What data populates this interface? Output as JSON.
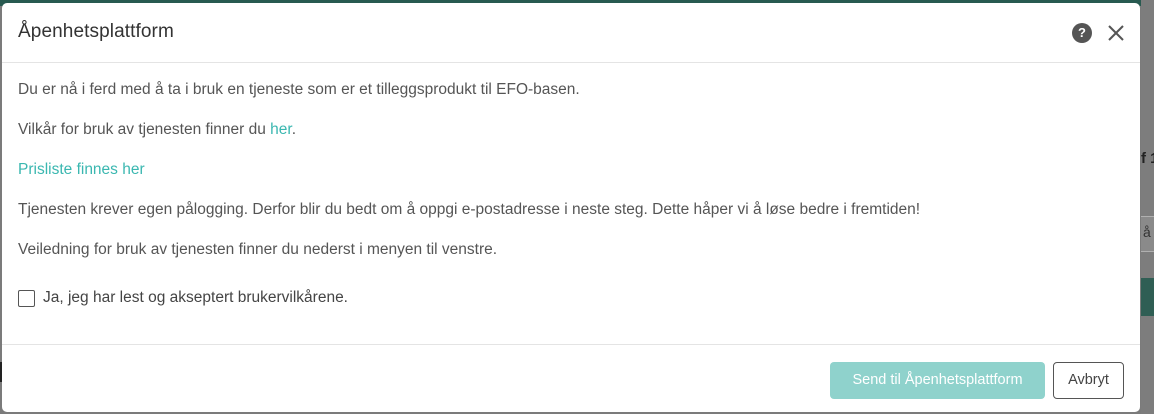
{
  "background": {
    "right_text": "f 1",
    "right_field_text": "å"
  },
  "modal": {
    "title": "Åpenhetsplattform",
    "help_glyph": "?",
    "body": {
      "line1": "Du er nå i ferd med å ta i bruk en tjeneste som er et tilleggsprodukt til EFO-basen.",
      "line2_prefix": "Vilkår for bruk av tjenesten finner du ",
      "line2_link": "her",
      "line2_suffix": ".",
      "price_link": "Prisliste finnes her",
      "line4": "Tjenesten krever egen pålogging. Derfor blir du bedt om å oppgi e-postadresse i neste steg. Dette håper vi å løse bedre i fremtiden!",
      "line5": "Veiledning for bruk av tjenesten finner du nederst i menyen til venstre."
    },
    "checkbox": {
      "label": "Ja, jeg har lest og akseptert brukervilkårene.",
      "checked": false
    },
    "footer": {
      "send_label": "Send til Åpenhetsplattform",
      "cancel_label": "Avbryt"
    }
  },
  "colors": {
    "accent": "#3ab7b0",
    "send_button_disabled": "#8fd2cc",
    "header_bar": "#285a50"
  },
  "icons": [
    "help-icon",
    "close-icon"
  ]
}
